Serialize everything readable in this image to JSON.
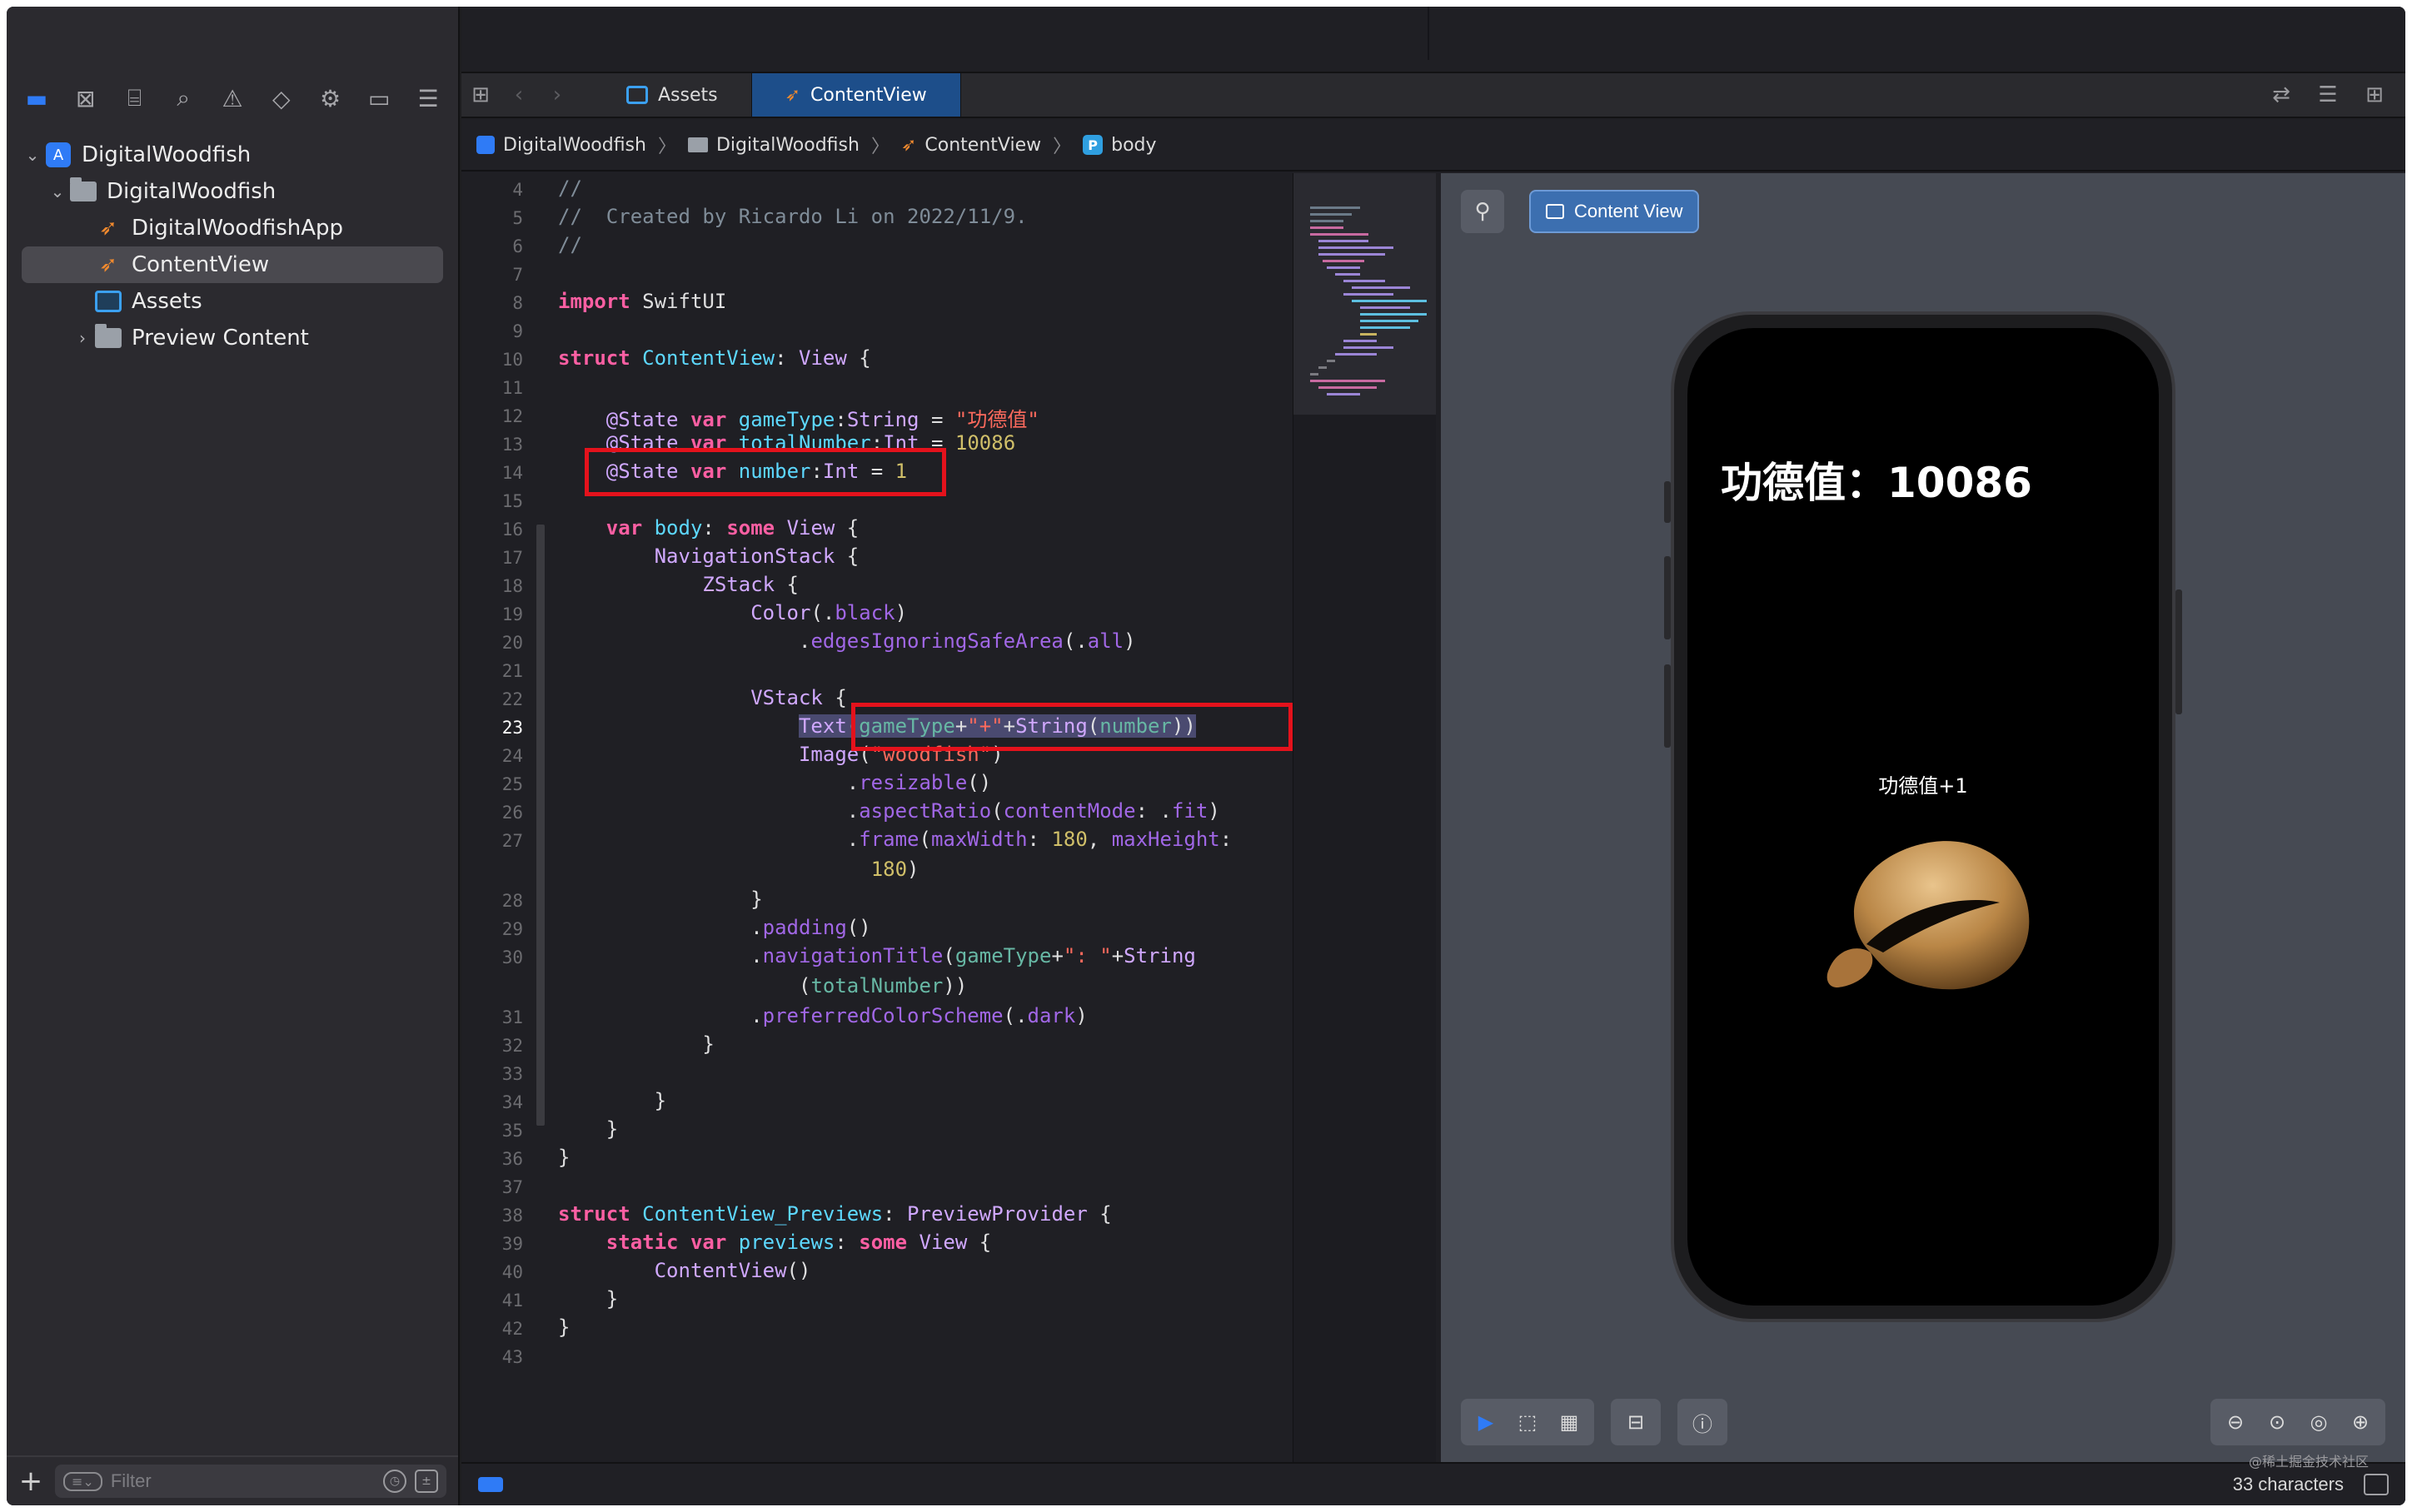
{
  "sidebar": {
    "nav_icons": [
      {
        "name": "folder-icon",
        "glyph": "▬",
        "active": true
      },
      {
        "name": "source-control-icon",
        "glyph": "⊠"
      },
      {
        "name": "bookmark-icon",
        "glyph": "⌸"
      },
      {
        "name": "search-icon",
        "glyph": "⌕"
      },
      {
        "name": "warning-icon",
        "glyph": "⚠"
      },
      {
        "name": "test-icon",
        "glyph": "◇"
      },
      {
        "name": "debug-icon",
        "glyph": "⚙"
      },
      {
        "name": "breakpoint-icon",
        "glyph": "▭"
      },
      {
        "name": "report-icon",
        "glyph": "☰"
      }
    ],
    "tree": [
      {
        "label": "DigitalWoodfish",
        "type": "project",
        "level": 0,
        "disclosure": "⌄"
      },
      {
        "label": "DigitalWoodfish",
        "type": "folder",
        "level": 1,
        "disclosure": "⌄"
      },
      {
        "label": "DigitalWoodfishApp",
        "type": "swift",
        "level": 2,
        "disclosure": ""
      },
      {
        "label": "ContentView",
        "type": "swift",
        "level": 2,
        "disclosure": "",
        "selected": true
      },
      {
        "label": "Assets",
        "type": "assets",
        "level": 2,
        "disclosure": ""
      },
      {
        "label": "Preview Content",
        "type": "folder",
        "level": 2,
        "disclosure": "›"
      }
    ],
    "filter_placeholder": "Filter"
  },
  "tabs": {
    "items": [
      {
        "label": "Assets",
        "icon": "assets-icon",
        "active": false
      },
      {
        "label": "ContentView",
        "icon": "swift-icon",
        "active": true
      }
    ]
  },
  "breadcrumb": [
    "DigitalWoodfish",
    "DigitalWoodfish",
    "ContentView",
    "body"
  ],
  "editor": {
    "current_line": 23,
    "lines": [
      {
        "n": "4",
        "html": "<span class='c-com'>//</span>"
      },
      {
        "n": "5",
        "html": "<span class='c-com'>//  Created by Ricardo Li on 2022/11/9.</span>"
      },
      {
        "n": "6",
        "html": "<span class='c-com'>//</span>"
      },
      {
        "n": "7",
        "html": ""
      },
      {
        "n": "8",
        "html": "<span class='c-kw'>import</span> SwiftUI"
      },
      {
        "n": "9",
        "html": ""
      },
      {
        "n": "10",
        "html": "<span class='c-kw'>struct</span> <span class='c-type'>ContentView</span>: <span class='c-tyo'>View</span> {"
      },
      {
        "n": "11",
        "html": ""
      },
      {
        "n": "12",
        "html": "    <span class='c-tyo'>@State</span> <span class='c-kw'>var</span> <span class='c-type'>gameType</span>:<span class='c-tyo'>String</span> = <span class='c-str'>\"功德值\"</span>"
      },
      {
        "n": "13",
        "html": "    <span class='c-tyo'>@State</span> <span class='c-kw'>var</span> <span class='c-type'>totalNumber</span>:<span class='c-tyo'>Int</span> = <span class='c-num'>10086</span>"
      },
      {
        "n": "14",
        "html": "    <span class='c-tyo'>@State</span> <span class='c-kw'>var</span> <span class='c-type'>number</span>:<span class='c-tyo'>Int</span> = <span class='c-num'>1</span>"
      },
      {
        "n": "15",
        "html": ""
      },
      {
        "n": "16",
        "html": "    <span class='c-kw'>var</span> <span class='c-type'>body</span>: <span class='c-kw'>some</span> <span class='c-tyo'>View</span> {"
      },
      {
        "n": "17",
        "html": "        <span class='c-tyo'>NavigationStack</span> {"
      },
      {
        "n": "18",
        "html": "            <span class='c-tyo'>ZStack</span> {"
      },
      {
        "n": "19",
        "html": "                <span class='c-tyo'>Color</span>(.<span class='c-prop'>black</span>)"
      },
      {
        "n": "20",
        "html": "                    .<span class='c-prop'>edgesIgnoringSafeArea</span>(.<span class='c-prop'>all</span>)"
      },
      {
        "n": "21",
        "html": ""
      },
      {
        "n": "22",
        "html": "                <span class='c-tyo'>VStack</span> {"
      },
      {
        "n": "23",
        "html": "                    <span class='sel'><span class='c-tyo'>Text</span>(<span class='c-var'>gameType</span>+<span class='c-str'>\"+\"</span>+<span class='c-tyo'>String</span>(<span class='c-var'>number</span>))</span>"
      },
      {
        "n": "24",
        "html": "                    <span class='c-tyo'>Image</span>(<span class='c-str'>\"woodfish\"</span>)"
      },
      {
        "n": "25",
        "html": "                        .<span class='c-prop'>resizable</span>()"
      },
      {
        "n": "26",
        "html": "                        .<span class='c-prop'>aspectRatio</span>(<span class='c-prop'>contentMode</span>: .<span class='c-prop'>fit</span>)"
      },
      {
        "n": "27",
        "html": "                        .<span class='c-prop'>frame</span>(<span class='c-prop'>maxWidth</span>: <span class='c-num'>180</span>, <span class='c-prop'>maxHeight</span>:"
      },
      {
        "n": "",
        "html": "                          <span class='c-num'>180</span>)"
      },
      {
        "n": "28",
        "html": "                }"
      },
      {
        "n": "29",
        "html": "                .<span class='c-prop'>padding</span>()"
      },
      {
        "n": "30",
        "html": "                .<span class='c-prop'>navigationTitle</span>(<span class='c-var'>gameType</span>+<span class='c-str'>\": \"</span>+<span class='c-tyo'>String</span>"
      },
      {
        "n": "",
        "html": "                    (<span class='c-var'>totalNumber</span>))"
      },
      {
        "n": "31",
        "html": "                .<span class='c-prop'>preferredColorScheme</span>(.<span class='c-prop'>dark</span>)"
      },
      {
        "n": "32",
        "html": "            }"
      },
      {
        "n": "33",
        "html": ""
      },
      {
        "n": "34",
        "html": "        }"
      },
      {
        "n": "35",
        "html": "    }"
      },
      {
        "n": "36",
        "html": "}"
      },
      {
        "n": "37",
        "html": ""
      },
      {
        "n": "38",
        "html": "<span class='c-kw'>struct</span> <span class='c-type'>ContentView_Previews</span>: <span class='c-tyo'>PreviewProvider</span> {"
      },
      {
        "n": "39",
        "html": "    <span class='c-kw'>static</span> <span class='c-kw'>var</span> <span class='c-type'>previews</span>: <span class='c-kw'>some</span> <span class='c-tyo'>View</span> {"
      },
      {
        "n": "40",
        "html": "        <span class='c-tyo'>ContentView</span>()"
      },
      {
        "n": "41",
        "html": "    }"
      },
      {
        "n": "42",
        "html": "}"
      },
      {
        "n": "43",
        "html": ""
      }
    ]
  },
  "preview": {
    "chip_label": "Content View",
    "nav_title": "功德值：10086",
    "merit_label": "功德值+1"
  },
  "status": {
    "char_count": "33 characters",
    "watermark": "@稀土掘金技术社区"
  },
  "colors": {
    "accent": "#2f7bf6",
    "highlight_box": "#e4121c",
    "active_tab": "#1d4e8a"
  }
}
